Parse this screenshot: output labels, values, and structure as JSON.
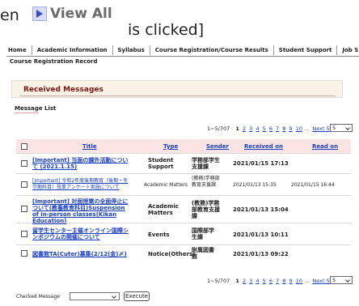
{
  "caption": {
    "prefix": "en",
    "button_text": "View All",
    "suffix": "is clicked]"
  },
  "nav": [
    "Home",
    "Academic Information",
    "Syllabus",
    "Course Registration/Course Results",
    "Student Support",
    "Job S"
  ],
  "subtitle": "Course Registration Record",
  "section_title": "Received Messages",
  "list_label": "Message List",
  "pagination": {
    "range": "1~5/707",
    "current": "1",
    "pages": [
      "2",
      "3",
      "4",
      "5",
      "6",
      "7",
      "8",
      "9",
      "10"
    ],
    "ellipsis": "...",
    "next": "Next 5>>",
    "select_value": "5"
  },
  "columns": {
    "title": "Title",
    "type": "Type",
    "sender": "Sender",
    "received": "Received on",
    "read": "Read on"
  },
  "messages": [
    {
      "title": "[Important] 当面の課外活動について (2021.1.15)",
      "type": "Student Support",
      "sender": "学務部学生支援課",
      "received": "2021/01/15 17:13",
      "read": "",
      "bold": true
    },
    {
      "title": "[Important] 令和2年度後期教育（後期・冬学期科目）授業アンケート実施について",
      "type": "Academic Matters",
      "sender": "(教務)学務部教育支援課",
      "received": "2021/01/13 15:35",
      "read": "2021/01/15 16:44",
      "bold": false
    },
    {
      "title": "[Important] 対面授業の全面停止について(教養教育科目)Suspension of in-person classes(Kikan Education)",
      "type": "Academic Matters",
      "sender": "(教務)学務部教育支援課",
      "received": "2021/01/13 15:04",
      "read": "",
      "bold": true
    },
    {
      "title": "留学生センター主催オンライン国際シンポジウムの開催について",
      "type": "Events",
      "sender": "国際部学生課",
      "received": "2021/01/13 10:11",
      "read": "",
      "bold": true
    },
    {
      "title": "図書館TA(Cuter)募集(2/12(金)〆)",
      "type": "Notice(Others)",
      "sender": "附属図書館",
      "received": "2021/01/13 09:22",
      "read": "",
      "bold": true
    }
  ],
  "bottom": {
    "label": "Checked Message",
    "execute": "Execute"
  }
}
